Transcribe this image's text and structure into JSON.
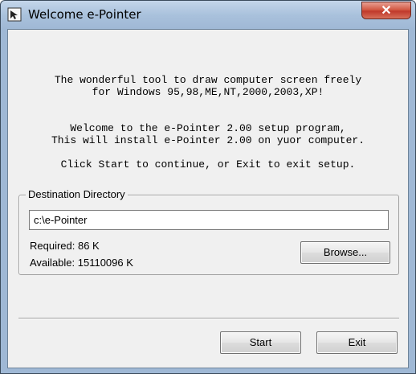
{
  "window": {
    "title": "Welcome e-Pointer",
    "close_glyph": "✕",
    "icon": "e-pointer-app-icon"
  },
  "intro": {
    "line1": "The wonderful tool to draw computer screen freely",
    "line2": "for Windows 95,98,ME,NT,2000,2003,XP!",
    "line3": "Welcome to the e-Pointer 2.00 setup program,",
    "line4": "This will install e-Pointer 2.00 on yuor computer.",
    "line5": "Click Start to continue, or Exit to exit setup."
  },
  "destination": {
    "group_label": "Destination Directory",
    "path_value": "c:\\e-Pointer",
    "required": "Required: 86 K",
    "available": "Available: 15110096 K",
    "browse_label": "Browse..."
  },
  "footer": {
    "start_label": "Start",
    "exit_label": "Exit"
  },
  "colors": {
    "titlebar": "#a9c1dc",
    "client_bg": "#f0f0f0",
    "close_button": "#c0392b"
  }
}
